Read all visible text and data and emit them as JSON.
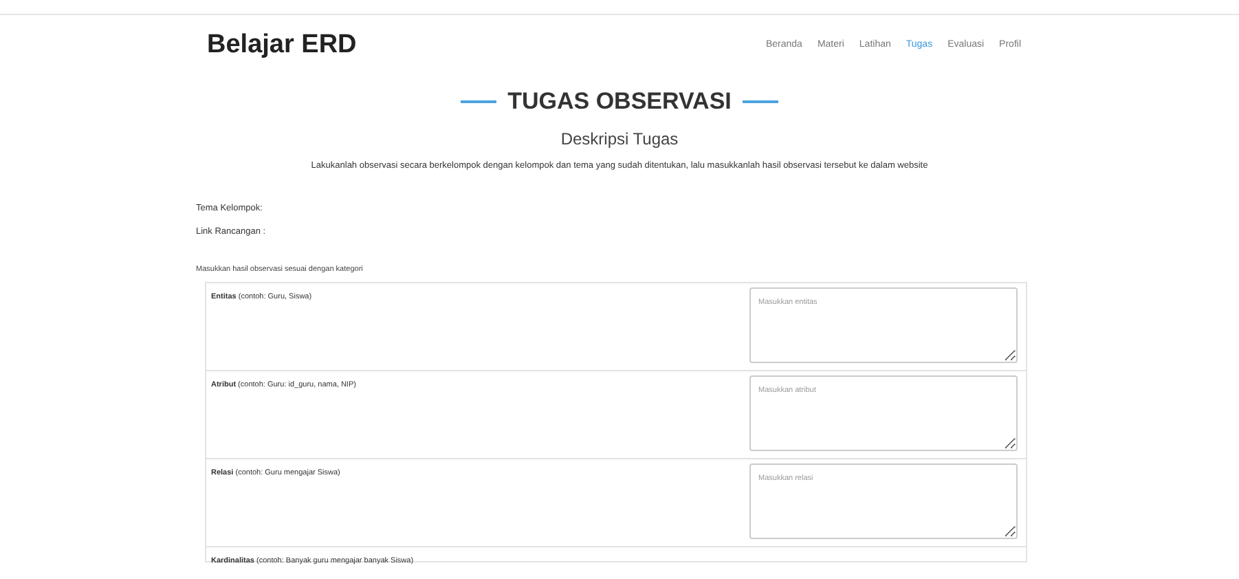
{
  "brand": "Belajar ERD",
  "nav": [
    {
      "label": "Beranda",
      "selected": false
    },
    {
      "label": "Materi",
      "selected": false
    },
    {
      "label": "Latihan",
      "selected": false
    },
    {
      "label": "Tugas",
      "selected": true
    },
    {
      "label": "Evaluasi",
      "selected": false
    },
    {
      "label": "Profil",
      "selected": false
    }
  ],
  "heading": "TUGAS OBSERVASI",
  "subheading": "Deskripsi Tugas",
  "description": "Lakukanlah observasi secara berkelompok dengan kelompok dan tema yang sudah ditentukan, lalu masukkanlah hasil observasi tersebut ke dalam website",
  "fields": [
    "Tema Kelompok:",
    "Link Rancangan :"
  ],
  "instruction": "Masukkan hasil observasi sesuai dengan kategori",
  "rows": [
    {
      "label": "**Entitas** (contoh: Guru, Siswa)",
      "placeholder": "Masukkan entitas"
    },
    {
      "label": "**Atribut** (contoh: Guru: id_guru, nama, NIP)",
      "placeholder": "Masukkan atribut"
    },
    {
      "label": "**Relasi** (contoh: Guru mengajar Siswa)",
      "placeholder": "Masukkan relasi"
    },
    {
      "label": "**Kardinalitas** (contoh: Banyak guru mengajar banyak Siswa)"
    }
  ]
}
